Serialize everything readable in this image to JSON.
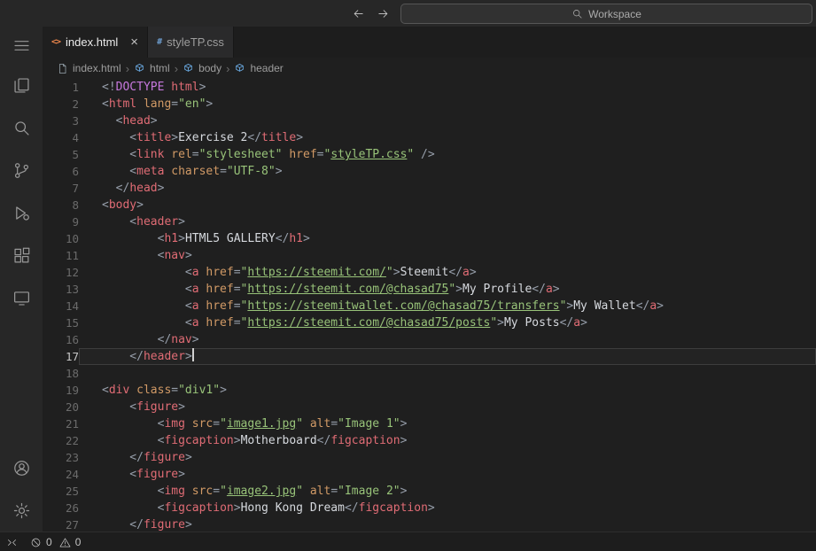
{
  "titlebar": {
    "search_label": "Workspace"
  },
  "activitybar": {
    "top": [
      "menu",
      "explorer",
      "search",
      "source-control",
      "run-debug",
      "extensions",
      "remote-explorer"
    ],
    "bottom": [
      "account",
      "settings"
    ]
  },
  "tabs": [
    {
      "label": "index.html",
      "icon": "html-file-icon",
      "glyph": "<>",
      "glyph_color": "#e8844a",
      "active": true,
      "close_label": "×"
    },
    {
      "label": "styleTP.css",
      "icon": "css-file-icon",
      "glyph": "#",
      "glyph_color": "#6e9fd1",
      "active": false
    }
  ],
  "breadcrumb": {
    "separator": "›",
    "items": [
      {
        "label": "index.html",
        "icon": "file",
        "color": "#9aa7b0"
      },
      {
        "label": "html",
        "icon": "cube",
        "color": "#75beff"
      },
      {
        "label": "body",
        "icon": "cube",
        "color": "#75beff"
      },
      {
        "label": "header",
        "icon": "cube",
        "color": "#75beff"
      }
    ]
  },
  "editor": {
    "cursor_line": 17,
    "lines": [
      {
        "n": 1,
        "tk": [
          [
            "p",
            "<!"
          ],
          [
            "d",
            "DOCTYPE"
          ],
          [
            "t",
            " html"
          ],
          [
            "p",
            ">"
          ]
        ]
      },
      {
        "n": 2,
        "tk": [
          [
            "p",
            "<"
          ],
          [
            "t",
            "html"
          ],
          [
            "a",
            " lang"
          ],
          [
            "p",
            "="
          ],
          [
            "s",
            "\"en\""
          ],
          [
            "p",
            ">"
          ]
        ]
      },
      {
        "n": 3,
        "tk": [
          [
            "p",
            "  <"
          ],
          [
            "t",
            "head"
          ],
          [
            "p",
            ">"
          ]
        ]
      },
      {
        "n": 4,
        "tk": [
          [
            "p",
            "    <"
          ],
          [
            "t",
            "title"
          ],
          [
            "p",
            ">"
          ],
          [
            "x",
            "Exercise 2"
          ],
          [
            "p",
            "</"
          ],
          [
            "t",
            "title"
          ],
          [
            "p",
            ">"
          ]
        ]
      },
      {
        "n": 5,
        "tk": [
          [
            "p",
            "    <"
          ],
          [
            "t",
            "link"
          ],
          [
            "a",
            " rel"
          ],
          [
            "p",
            "="
          ],
          [
            "s",
            "\"stylesheet\""
          ],
          [
            "a",
            " href"
          ],
          [
            "p",
            "="
          ],
          [
            "s",
            "\""
          ],
          [
            "u",
            "styleTP.css"
          ],
          [
            "s",
            "\""
          ],
          [
            "p",
            " />"
          ]
        ]
      },
      {
        "n": 6,
        "tk": [
          [
            "p",
            "    <"
          ],
          [
            "t",
            "meta"
          ],
          [
            "a",
            " charset"
          ],
          [
            "p",
            "="
          ],
          [
            "s",
            "\"UTF-8\""
          ],
          [
            "p",
            ">"
          ]
        ]
      },
      {
        "n": 7,
        "tk": [
          [
            "p",
            "  </"
          ],
          [
            "t",
            "head"
          ],
          [
            "p",
            ">"
          ]
        ]
      },
      {
        "n": 8,
        "tk": [
          [
            "p",
            "<"
          ],
          [
            "t",
            "body"
          ],
          [
            "p",
            ">"
          ]
        ]
      },
      {
        "n": 9,
        "tk": [
          [
            "p",
            "    <"
          ],
          [
            "t",
            "header"
          ],
          [
            "p",
            ">"
          ]
        ]
      },
      {
        "n": 10,
        "tk": [
          [
            "p",
            "        <"
          ],
          [
            "t",
            "h1"
          ],
          [
            "p",
            ">"
          ],
          [
            "x",
            "HTML5 GALLERY"
          ],
          [
            "p",
            "</"
          ],
          [
            "t",
            "h1"
          ],
          [
            "p",
            ">"
          ]
        ]
      },
      {
        "n": 11,
        "tk": [
          [
            "p",
            "        <"
          ],
          [
            "t",
            "nav"
          ],
          [
            "p",
            ">"
          ]
        ]
      },
      {
        "n": 12,
        "tk": [
          [
            "p",
            "            <"
          ],
          [
            "t",
            "a"
          ],
          [
            "a",
            " href"
          ],
          [
            "p",
            "="
          ],
          [
            "s",
            "\""
          ],
          [
            "u",
            "https://steemit.com/"
          ],
          [
            "s",
            "\""
          ],
          [
            "p",
            ">"
          ],
          [
            "x",
            "Steemit"
          ],
          [
            "p",
            "</"
          ],
          [
            "t",
            "a"
          ],
          [
            "p",
            ">"
          ]
        ]
      },
      {
        "n": 13,
        "tk": [
          [
            "p",
            "            <"
          ],
          [
            "t",
            "a"
          ],
          [
            "a",
            " href"
          ],
          [
            "p",
            "="
          ],
          [
            "s",
            "\""
          ],
          [
            "u",
            "https://steemit.com/@chasad75"
          ],
          [
            "s",
            "\""
          ],
          [
            "p",
            ">"
          ],
          [
            "x",
            "My Profile"
          ],
          [
            "p",
            "</"
          ],
          [
            "t",
            "a"
          ],
          [
            "p",
            ">"
          ]
        ]
      },
      {
        "n": 14,
        "tk": [
          [
            "p",
            "            <"
          ],
          [
            "t",
            "a"
          ],
          [
            "a",
            " href"
          ],
          [
            "p",
            "="
          ],
          [
            "s",
            "\""
          ],
          [
            "u",
            "https://steemitwallet.com/@chasad75/transfers"
          ],
          [
            "s",
            "\""
          ],
          [
            "p",
            ">"
          ],
          [
            "x",
            "My Wallet"
          ],
          [
            "p",
            "</"
          ],
          [
            "t",
            "a"
          ],
          [
            "p",
            ">"
          ]
        ]
      },
      {
        "n": 15,
        "tk": [
          [
            "p",
            "            <"
          ],
          [
            "t",
            "a"
          ],
          [
            "a",
            " href"
          ],
          [
            "p",
            "="
          ],
          [
            "s",
            "\""
          ],
          [
            "u",
            "https://steemit.com/@chasad75/posts"
          ],
          [
            "s",
            "\""
          ],
          [
            "p",
            ">"
          ],
          [
            "x",
            "My Posts"
          ],
          [
            "p",
            "</"
          ],
          [
            "t",
            "a"
          ],
          [
            "p",
            ">"
          ]
        ]
      },
      {
        "n": 16,
        "tk": [
          [
            "p",
            "        </"
          ],
          [
            "t",
            "nav"
          ],
          [
            "p",
            ">"
          ]
        ]
      },
      {
        "n": 17,
        "tk": [
          [
            "p",
            "    </"
          ],
          [
            "t",
            "header"
          ],
          [
            "p",
            ">"
          ]
        ]
      },
      {
        "n": 18,
        "tk": []
      },
      {
        "n": 19,
        "tk": [
          [
            "p",
            "<"
          ],
          [
            "t",
            "div"
          ],
          [
            "a",
            " class"
          ],
          [
            "p",
            "="
          ],
          [
            "s",
            "\"div1\""
          ],
          [
            "p",
            ">"
          ]
        ]
      },
      {
        "n": 20,
        "tk": [
          [
            "p",
            "    <"
          ],
          [
            "t",
            "figure"
          ],
          [
            "p",
            ">"
          ]
        ]
      },
      {
        "n": 21,
        "tk": [
          [
            "p",
            "        <"
          ],
          [
            "t",
            "img"
          ],
          [
            "a",
            " src"
          ],
          [
            "p",
            "="
          ],
          [
            "s",
            "\""
          ],
          [
            "u",
            "image1.jpg"
          ],
          [
            "s",
            "\""
          ],
          [
            "a",
            " alt"
          ],
          [
            "p",
            "="
          ],
          [
            "s",
            "\"Image 1\""
          ],
          [
            "p",
            ">"
          ]
        ]
      },
      {
        "n": 22,
        "tk": [
          [
            "p",
            "        <"
          ],
          [
            "t",
            "figcaption"
          ],
          [
            "p",
            ">"
          ],
          [
            "x",
            "Motherboard"
          ],
          [
            "p",
            "</"
          ],
          [
            "t",
            "figcaption"
          ],
          [
            "p",
            ">"
          ]
        ]
      },
      {
        "n": 23,
        "tk": [
          [
            "p",
            "    </"
          ],
          [
            "t",
            "figure"
          ],
          [
            "p",
            ">"
          ]
        ]
      },
      {
        "n": 24,
        "tk": [
          [
            "p",
            "    <"
          ],
          [
            "t",
            "figure"
          ],
          [
            "p",
            ">"
          ]
        ]
      },
      {
        "n": 25,
        "tk": [
          [
            "p",
            "        <"
          ],
          [
            "t",
            "img"
          ],
          [
            "a",
            " src"
          ],
          [
            "p",
            "="
          ],
          [
            "s",
            "\""
          ],
          [
            "u",
            "image2.jpg"
          ],
          [
            "s",
            "\""
          ],
          [
            "a",
            " alt"
          ],
          [
            "p",
            "="
          ],
          [
            "s",
            "\"Image 2\""
          ],
          [
            "p",
            ">"
          ]
        ]
      },
      {
        "n": 26,
        "tk": [
          [
            "p",
            "        <"
          ],
          [
            "t",
            "figcaption"
          ],
          [
            "p",
            ">"
          ],
          [
            "x",
            "Hong Kong Dream"
          ],
          [
            "p",
            "</"
          ],
          [
            "t",
            "figcaption"
          ],
          [
            "p",
            ">"
          ]
        ]
      },
      {
        "n": 27,
        "tk": [
          [
            "p",
            "    </"
          ],
          [
            "t",
            "figure"
          ],
          [
            "p",
            ">"
          ]
        ]
      }
    ]
  },
  "statusbar": {
    "errors": "0",
    "warnings": "0"
  },
  "colors": {
    "editor_bg": "#1f1f1f",
    "tag": "#e06c75",
    "attr": "#d19a66",
    "string": "#98c379",
    "punct": "#969eaa",
    "text": "#d6d9de",
    "doctype": "#c678dd"
  }
}
